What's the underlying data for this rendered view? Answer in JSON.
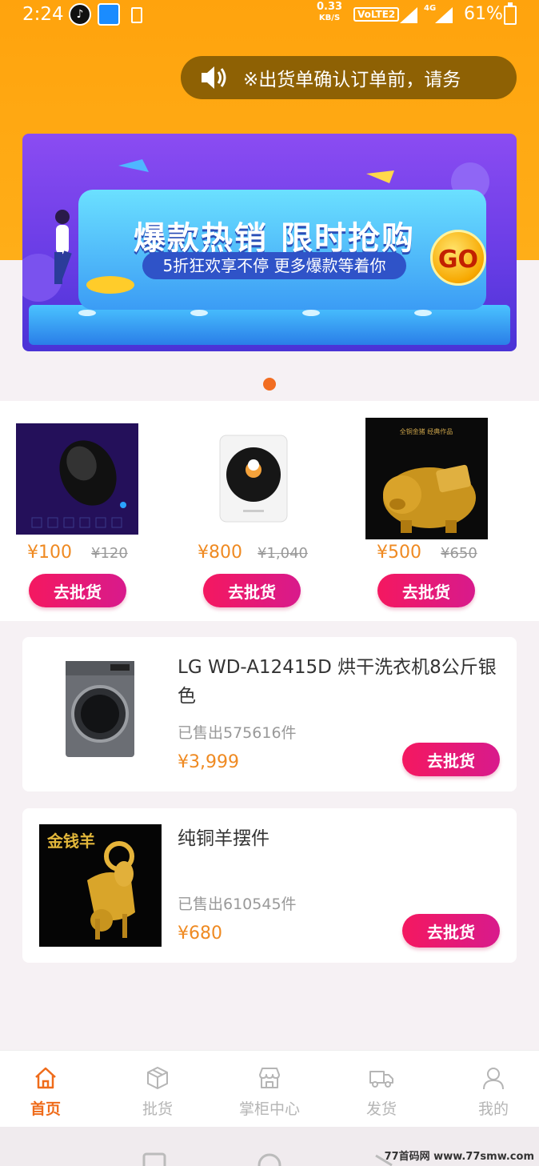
{
  "status_bar": {
    "time": "2:24",
    "net_speed_value": "0.33",
    "net_speed_unit": "KB/S",
    "volte": "VoLTE2",
    "network": "4G",
    "battery": "61%"
  },
  "notice": {
    "icon": "speaker-icon",
    "text": "※出货单确认订单前，请务"
  },
  "banner": {
    "title": "爆款热销 限时抢购",
    "subtitle": "5折狂欢享不停 更多爆款等着你",
    "go": "GO"
  },
  "featured": [
    {
      "price": "¥100",
      "old_price": "¥120",
      "button": "去批货",
      "image": "gaming-mouse"
    },
    {
      "price": "¥800",
      "old_price": "¥1,040",
      "button": "去批货",
      "image": "smart-device"
    },
    {
      "price": "¥500",
      "old_price": "¥650",
      "button": "去批货",
      "image": "golden-pig"
    }
  ],
  "featured_image_text": "全铜金猪 经典作品",
  "products": [
    {
      "title": "LG WD-A12415D 烘干洗衣机8公斤银色",
      "sold": "已售出575616件",
      "price": "¥3,999",
      "button": "去批货",
      "image": "washing-machine"
    },
    {
      "title": "纯铜羊摆件",
      "sold": "已售出610545件",
      "price": "¥680",
      "button": "去批货",
      "image": "golden-goat",
      "image_text": "金钱羊"
    }
  ],
  "tabbar": [
    {
      "label": "首页",
      "icon": "home-icon",
      "active": true
    },
    {
      "label": "批货",
      "icon": "box-icon",
      "active": false
    },
    {
      "label": "掌柜中心",
      "icon": "store-icon",
      "active": false
    },
    {
      "label": "发货",
      "icon": "truck-icon",
      "active": false
    },
    {
      "label": "我的",
      "icon": "user-icon",
      "active": false
    }
  ],
  "watermark": "77首码网 www.77smw.com",
  "colors": {
    "header_orange": "#ffa30d",
    "price_orange": "#ef8a22",
    "button_pink": "#f41860",
    "active_tab": "#ef6b1a"
  }
}
